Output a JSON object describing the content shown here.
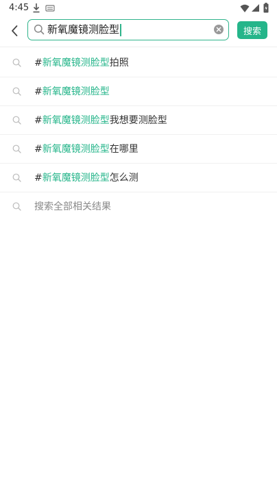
{
  "status": {
    "time": "4:45",
    "icons": [
      "download-icon",
      "keyboard-icon",
      "wifi-icon",
      "signal-icon",
      "battery-icon"
    ]
  },
  "header": {
    "search_value": "新氧魔镜测脸型",
    "search_button_label": "搜索"
  },
  "suggestions": [
    {
      "prefix": "#",
      "highlight": "新氧魔镜测脸型",
      "suffix": "拍照"
    },
    {
      "prefix": "#",
      "highlight": "新氧魔镜测脸型",
      "suffix": ""
    },
    {
      "prefix": "#",
      "highlight": "新氧魔镜测脸型",
      "suffix": "我想要测脸型"
    },
    {
      "prefix": "#",
      "highlight": "新氧魔镜测脸型",
      "suffix": "在哪里"
    },
    {
      "prefix": "#",
      "highlight": "新氧魔镜测脸型",
      "suffix": "怎么测"
    }
  ],
  "search_all_label": "搜索全部相关结果",
  "colors": {
    "accent": "#25b58a",
    "text": "#333333",
    "muted": "#888888"
  }
}
